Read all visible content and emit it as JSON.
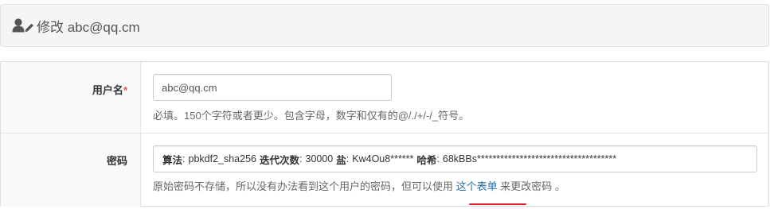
{
  "header": {
    "title": "修改 abc@qq.cm",
    "icon": "user-edit-icon"
  },
  "form": {
    "username": {
      "label": "用户名",
      "required_mark": "*",
      "value": "abc@qq.cm",
      "help": "必填。150个字符或者更少。包含字母，数字和仅有的@/./+/-/_符号。"
    },
    "password": {
      "label": "密码",
      "algorithm_label": "算法",
      "algorithm_value": "pbkdf2_sha256",
      "iterations_label": "迭代次数",
      "iterations_value": "30000",
      "salt_label": "盐",
      "salt_value": "Kw4Ou8******",
      "hash_label": "哈希",
      "hash_value": "68kBBs************************************",
      "help_before": "原始密码不存储，所以没有办法看到这个用户的密码，但可以使用",
      "help_link": "这个表单",
      "help_after": "来更改密码 。"
    }
  },
  "colors": {
    "link": "#2a6fb0",
    "required": "#d9534f",
    "annotation_underline": "#e0202a"
  }
}
